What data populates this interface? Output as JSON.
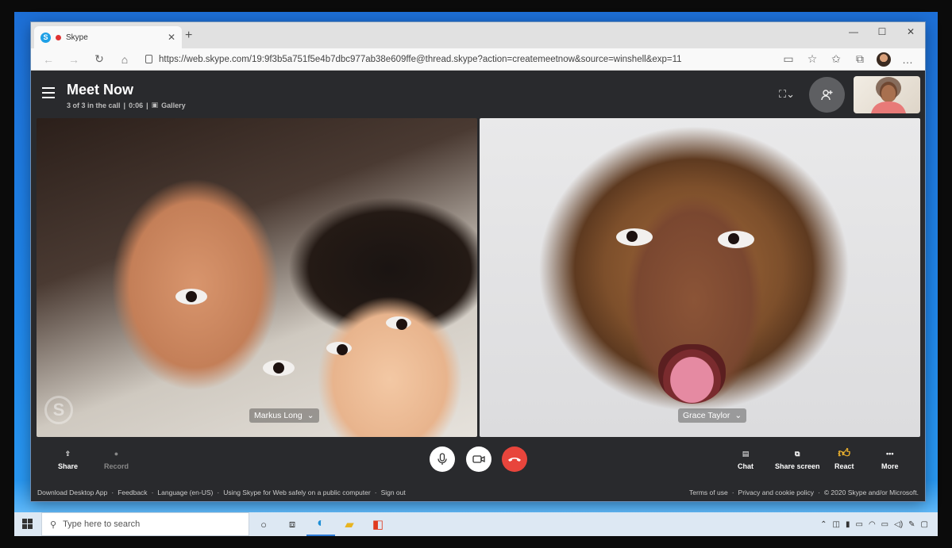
{
  "browser": {
    "tab_title": "Skype",
    "new_tab_label": "+",
    "url": "https://web.skype.com/19:9f3b5a751f5e4b7dbc977ab38e609ffe@thread.skype?action=createmeetnow&source=winshell&exp=11"
  },
  "meeting": {
    "title": "Meet Now",
    "status": "3 of 3 in the call",
    "duration": "0:06",
    "view_mode": "Gallery"
  },
  "participants": [
    {
      "name": "Markus Long"
    },
    {
      "name": "Grace Taylor"
    }
  ],
  "controls": {
    "share": "Share",
    "record": "Record",
    "chat": "Chat",
    "share_screen": "Share screen",
    "react": "React",
    "more": "More"
  },
  "footer": {
    "left_links": [
      "Download Desktop App",
      "Feedback",
      "Language (en-US)",
      "Using Skype for Web safely on a public computer",
      "Sign out"
    ],
    "terms": "Terms of use",
    "privacy": "Privacy and cookie policy",
    "copyright": "© 2020 Skype and/or Microsoft."
  },
  "taskbar": {
    "search_placeholder": "Type here to search"
  },
  "colors": {
    "app_background": "#292a2d",
    "end_call": "#e8453c",
    "skype_blue": "#1ea0e6"
  }
}
